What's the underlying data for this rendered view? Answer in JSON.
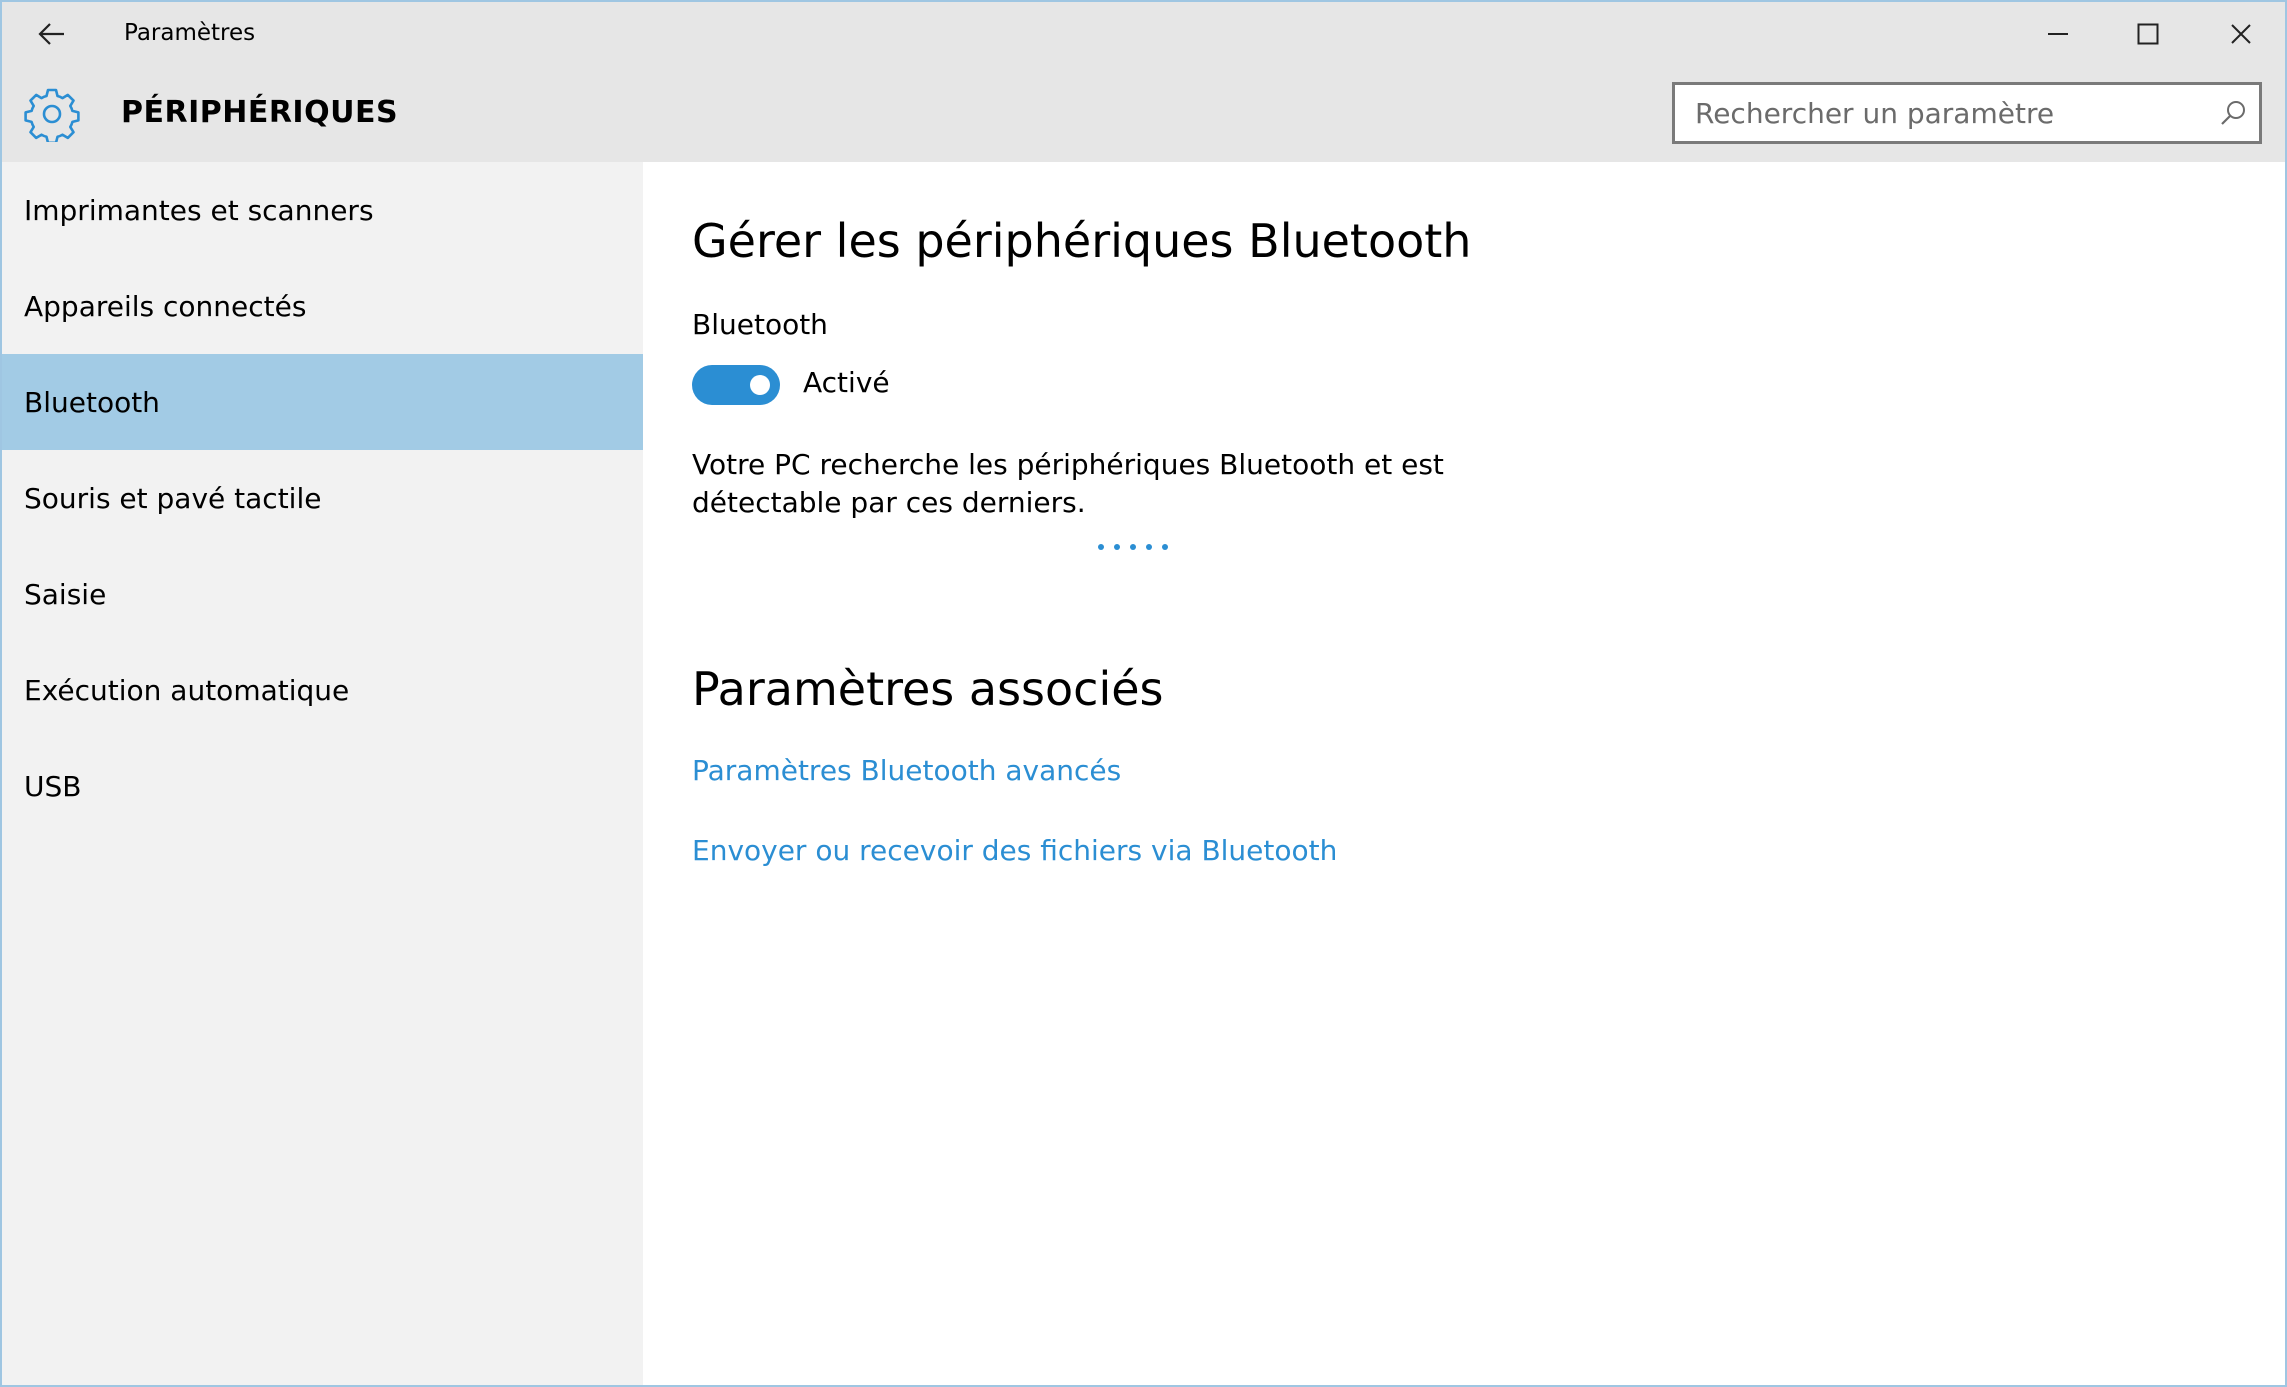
{
  "window": {
    "title": "Paramètres"
  },
  "header": {
    "title": "PÉRIPHÉRIQUES",
    "icon": "gear-icon"
  },
  "search": {
    "placeholder": "Rechercher un paramètre",
    "value": ""
  },
  "sidebar": {
    "items": [
      {
        "label": "Imprimantes et scanners"
      },
      {
        "label": "Appareils connectés"
      },
      {
        "label": "Bluetooth",
        "selected": true
      },
      {
        "label": "Souris et pavé tactile"
      },
      {
        "label": "Saisie"
      },
      {
        "label": "Exécution automatique"
      },
      {
        "label": "USB"
      }
    ]
  },
  "main": {
    "title": "Gérer les périphériques Bluetooth",
    "toggle": {
      "label": "Bluetooth",
      "state": "Activé",
      "on": true
    },
    "description": "Votre PC recherche les périphériques Bluetooth et est détectable par ces derniers.",
    "related": {
      "title": "Paramètres associés",
      "links": [
        {
          "label": "Paramètres Bluetooth avancés"
        },
        {
          "label": "Envoyer ou recevoir des fichiers via Bluetooth"
        }
      ]
    }
  },
  "colors": {
    "accent": "#2b8ed3",
    "selected_bg": "#a2cbe5",
    "sidebar_bg": "#f2f2f2",
    "header_bg": "#e6e6e6"
  }
}
